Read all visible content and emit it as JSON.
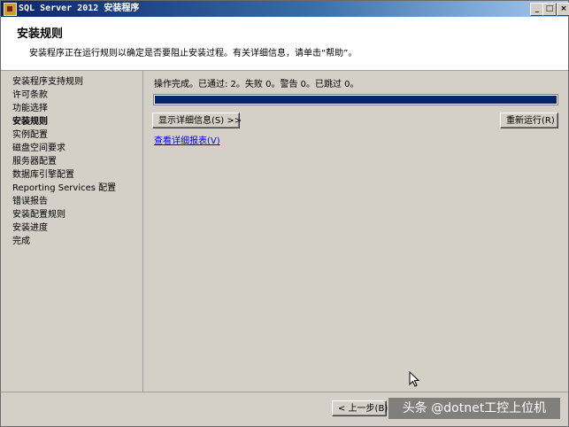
{
  "window": {
    "title": "SQL Server 2012 安装程序",
    "minimize_glyph": "_",
    "maximize_glyph": "□",
    "close_glyph": "×"
  },
  "header": {
    "title": "安装规则",
    "subtitle": "安装程序正在运行规则以确定是否要阻止安装过程。有关详细信息，请单击“帮助”。"
  },
  "nav": {
    "items": [
      {
        "label": "安装程序支持规则",
        "active": false
      },
      {
        "label": "许可条款",
        "active": false
      },
      {
        "label": "功能选择",
        "active": false
      },
      {
        "label": "安装规则",
        "active": true
      },
      {
        "label": "实例配置",
        "active": false
      },
      {
        "label": "磁盘空间要求",
        "active": false
      },
      {
        "label": "服务器配置",
        "active": false
      },
      {
        "label": "数据库引擎配置",
        "active": false
      },
      {
        "label": "Reporting Services 配置",
        "active": false
      },
      {
        "label": "错误报告",
        "active": false
      },
      {
        "label": "安装配置规则",
        "active": false
      },
      {
        "label": "安装进度",
        "active": false
      },
      {
        "label": "完成",
        "active": false
      }
    ]
  },
  "main": {
    "status_text": "操作完成。已通过: 2。失败 0。警告 0。已跳过 0。",
    "progress_fraction": 1.0,
    "show_details_button": "显示详细信息(S) >>",
    "rerun_button": "重新运行(R)",
    "view_report_link": "查看详细报表(V)"
  },
  "footer": {
    "back_button": "< 上一步(B)"
  },
  "watermark": {
    "text": "头条 @dotnet工控上位机"
  },
  "colors": {
    "progress_fill": "#0a246a",
    "title_gradient_start": "#0a246a",
    "link": "#0000ee"
  }
}
